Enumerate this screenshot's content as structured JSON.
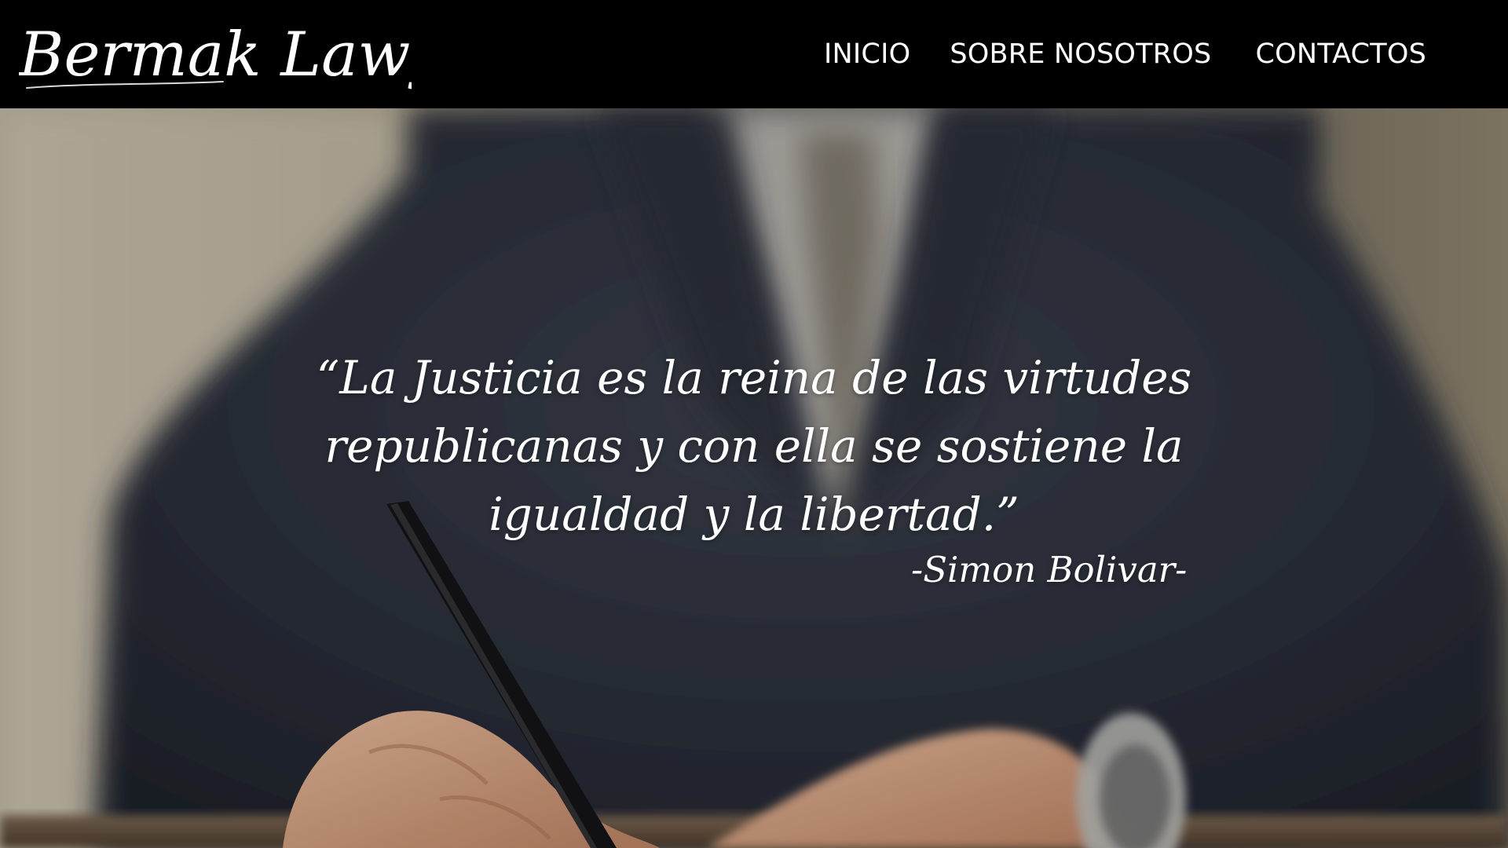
{
  "header": {
    "logo_text": "Bermak Lawyers"
  },
  "nav": {
    "items": [
      {
        "label": "INICIO"
      },
      {
        "label": "SOBRE NOSOTROS"
      },
      {
        "label": "CONTACTOS"
      }
    ]
  },
  "hero": {
    "quote": "“La Justicia es la reina de las virtudes republicanas y con ella se sostiene la igualdad y la libertad.”",
    "author": "-Simon Bolivar-"
  },
  "colors": {
    "navbar_bg": "#000000",
    "text": "#ffffff"
  }
}
